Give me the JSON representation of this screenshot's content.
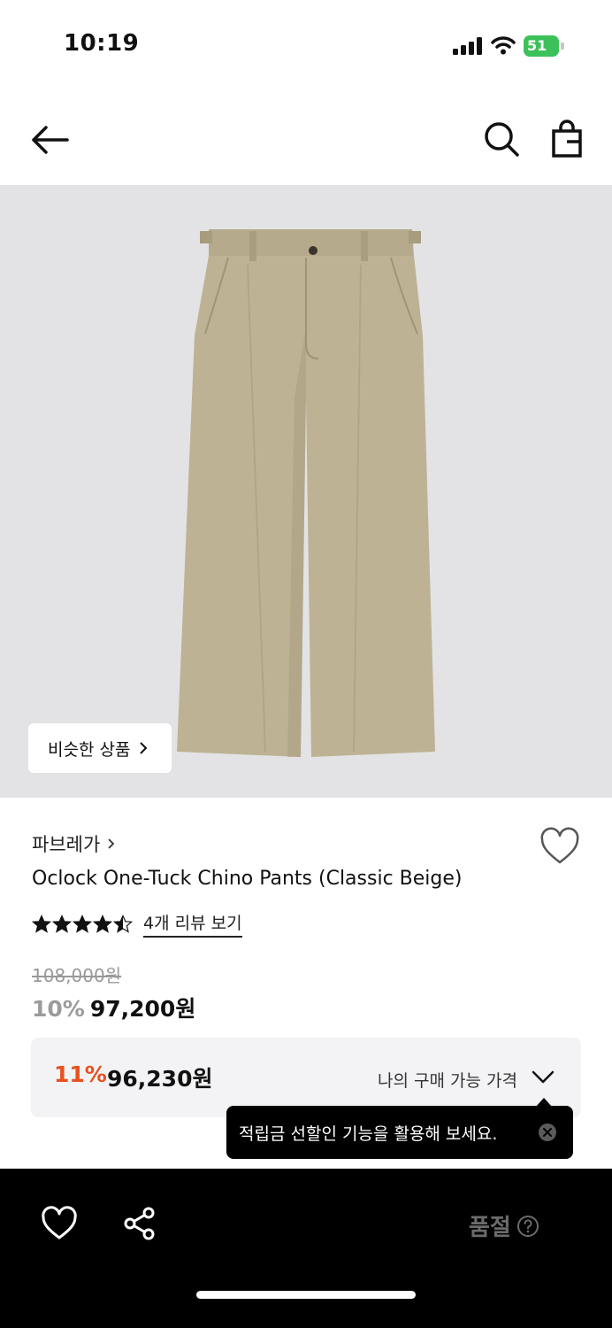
{
  "status_bar": {
    "time": "10:19",
    "battery": "51"
  },
  "product": {
    "similar_label": "비슷한 상품",
    "brand": "파브레가",
    "name": "Oclock One-Tuck Chino Pants (Classic Beige)",
    "rating": 4.5,
    "reviews_label": "4개 리뷰 보기",
    "original_price": "108,000원",
    "discount": "10%",
    "price": "97,200원"
  },
  "my_price": {
    "discount": "11%",
    "price": "96,230원",
    "label": "나의 구매 가능 가격"
  },
  "tooltip": {
    "text": "적립금 선할인 기능을 활용해 보세요."
  },
  "bottom_bar": {
    "soldout_label": "품절"
  },
  "colors": {
    "accent_discount": "#e8501f",
    "battery": "#3cc15a",
    "image_bg": "#e3e3e5",
    "pants": "#bdb294"
  }
}
